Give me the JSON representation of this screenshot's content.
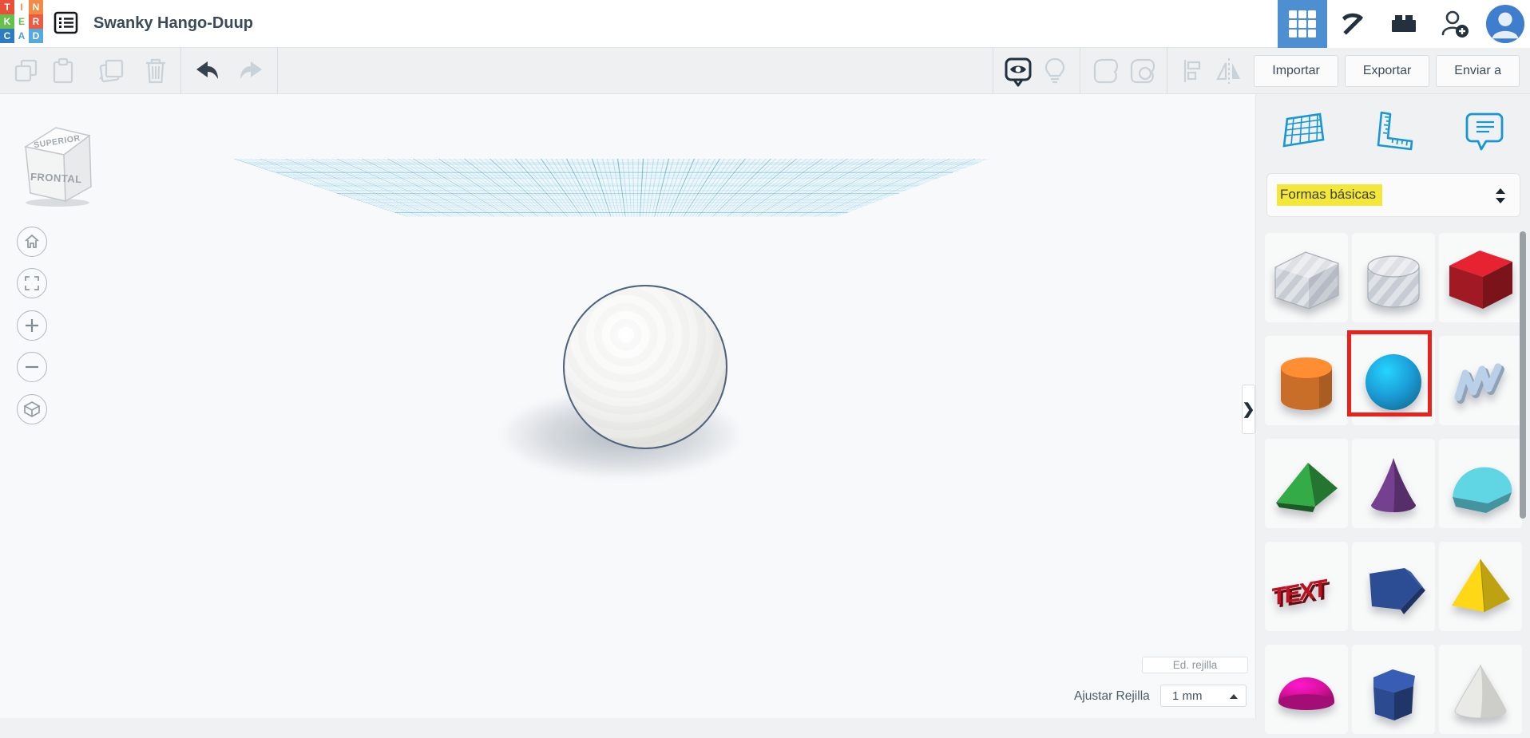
{
  "app": {
    "title": "Swanky Hango-Duup",
    "logo_letters": [
      "T",
      "I",
      "N",
      "K",
      "E",
      "R",
      "C",
      "A",
      "D"
    ]
  },
  "toolbar": {
    "import_label": "Importar",
    "export_label": "Exportar",
    "send_label": "Enviar a",
    "left_icons": [
      "copy-icon",
      "paste-icon",
      "duplicate-icon",
      "delete-icon",
      "undo-icon",
      "redo-icon"
    ],
    "right_icons": [
      "workplane-view-icon",
      "light-bulb-icon",
      "solid-shape-icon",
      "hole-shape-icon",
      "align-icon",
      "mirror-icon"
    ]
  },
  "canvas": {
    "viewcube": {
      "top": "SUPERIOR",
      "front": "FRONTAL"
    },
    "nav_icons": [
      "home-icon",
      "fit-view-icon",
      "zoom-in-icon",
      "zoom-out-icon",
      "perspective-icon"
    ],
    "collapse_chevron": "❯",
    "edit_grid_label": "Ed. rejilla",
    "snap_grid_label": "Ajustar Rejilla",
    "grid_size_value": "1 mm"
  },
  "panel": {
    "tool_icons": [
      "workplane-tool-icon",
      "ruler-tool-icon",
      "notes-tool-icon"
    ],
    "category_select": {
      "value": "Formas básicas",
      "highlighted": true
    },
    "shapes": [
      {
        "id": "box-hole",
        "color": "#d4d9df",
        "selected": false
      },
      {
        "id": "cylinder-hole",
        "color": "#d4d9df",
        "selected": false
      },
      {
        "id": "box",
        "color": "#c41e2a",
        "selected": false
      },
      {
        "id": "cylinder",
        "color": "#d3742a",
        "selected": false
      },
      {
        "id": "sphere",
        "color": "#1b9ed9",
        "selected": true
      },
      {
        "id": "scribble",
        "color": "#b9d0e8",
        "selected": false
      },
      {
        "id": "roof",
        "color": "#2f9e41",
        "selected": false
      },
      {
        "id": "cone",
        "color": "#74408f",
        "selected": false
      },
      {
        "id": "round-roof",
        "color": "#56becb",
        "selected": false
      },
      {
        "id": "text",
        "color": "#bc1220",
        "selected": false
      },
      {
        "id": "polygon",
        "color": "#2c4d94",
        "selected": false
      },
      {
        "id": "pyramid",
        "color": "#e3c114",
        "selected": false
      },
      {
        "id": "half-sphere",
        "color": "#d8119b",
        "selected": false
      },
      {
        "id": "hex-prism",
        "color": "#2c4a90",
        "selected": false
      },
      {
        "id": "paraboloid",
        "color": "#e9e9e6",
        "selected": false
      }
    ]
  },
  "colors": {
    "accent_blue": "#1797d5",
    "header_active_tile": "#4d8fd0",
    "selection_red": "#e8231d",
    "highlight_yellow": "#f3e73b",
    "grid_line": "#5bb4d6",
    "dark_icon": "#22313d",
    "disabled_icon": "#c9d2d9",
    "title_text": "#3b4a57"
  }
}
